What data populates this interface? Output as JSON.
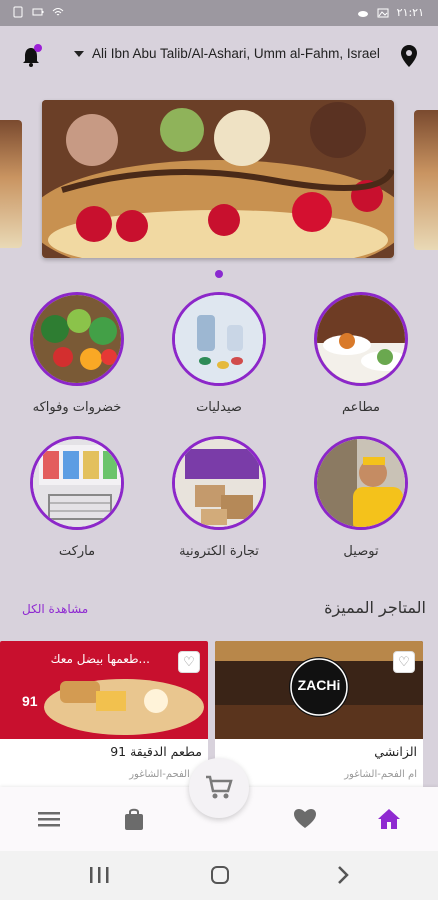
{
  "status_bar": {
    "time": "٢١:٢١",
    "left_icons": [
      "sim-icon",
      "wifi-icon",
      "battery-icon"
    ],
    "right_icons": [
      "cloud-icon",
      "image-icon",
      "signal-icon"
    ]
  },
  "header": {
    "address": "Ali Ibn Abu Talib/Al-Ashari, Umm al-Fahm, Israel",
    "bell_icon": "bell-icon",
    "location_icon": "location-pin-icon"
  },
  "carousel": {
    "active_index": 0
  },
  "categories": [
    {
      "key": "restaurants",
      "label": "مطاعم"
    },
    {
      "key": "pharmacies",
      "label": "صيدليات"
    },
    {
      "key": "vegetables",
      "label": "خضروات وفواكه"
    },
    {
      "key": "delivery",
      "label": "توصيل"
    },
    {
      "key": "ecommerce",
      "label": "تجارة الكترونية"
    },
    {
      "key": "market",
      "label": "ماركت"
    }
  ],
  "featured": {
    "title": "المتاجر المميزة",
    "see_all": "مشاهدة الكل",
    "stores": [
      {
        "name": "الزانشي",
        "location": "ام الفحم-الشاغور",
        "logo_text": "ZACHi"
      },
      {
        "name": "مطعم الدقيقة 91",
        "location": "ام الفحم-الشاغور",
        "banner_text": "طعمها بيضل معك..."
      }
    ]
  },
  "bottom_nav": {
    "items": [
      "home-icon",
      "heart-icon",
      "bag-icon",
      "menu-icon"
    ],
    "cart_icon": "cart-icon"
  },
  "colors": {
    "accent": "#8c27c9",
    "background": "#d8d2dc",
    "nav_active": "#8f2ad1"
  }
}
